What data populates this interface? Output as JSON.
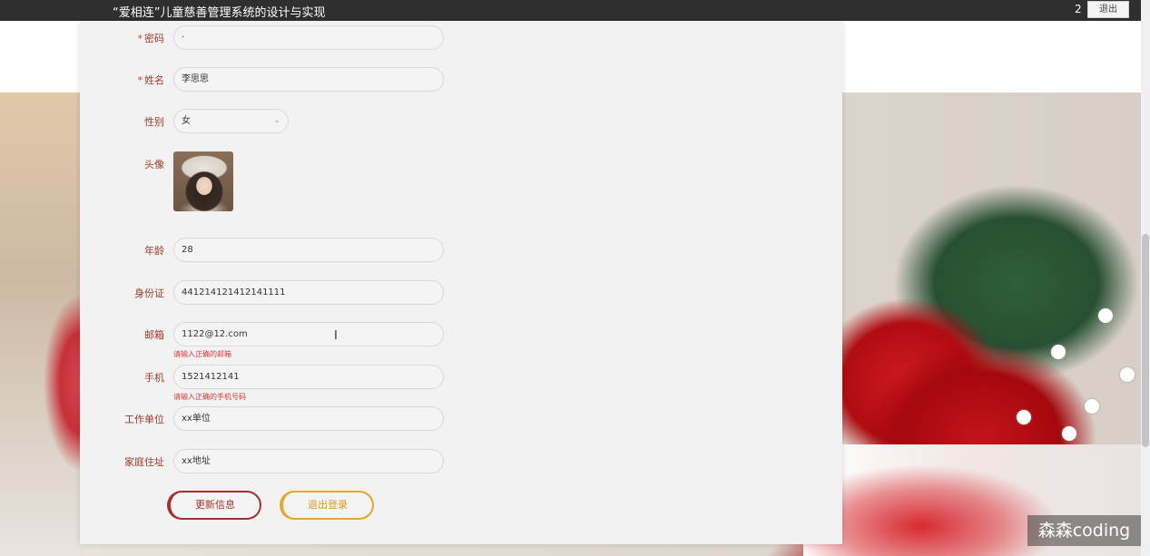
{
  "header": {
    "title": "“爱相连”儿童慈善管理系统的设计与实现",
    "user_number": "2",
    "logout_label": "退出"
  },
  "form": {
    "password": {
      "label": "密码",
      "required": "*",
      "value": "·"
    },
    "name": {
      "label": "姓名",
      "required": "*",
      "value": "李思思"
    },
    "gender": {
      "label": "性别",
      "value": "女"
    },
    "avatar": {
      "label": "头像"
    },
    "age": {
      "label": "年龄",
      "value": "28"
    },
    "id_card": {
      "label": "身份证",
      "value": "441214121412141111"
    },
    "email": {
      "label": "邮箱",
      "value": "1122@12.com",
      "error": "请输入正确的邮箱"
    },
    "phone": {
      "label": "手机",
      "value": "1521412141",
      "error": "请输入正确的手机号码"
    },
    "work_unit": {
      "label": "工作单位",
      "value": "xx单位"
    },
    "home_address": {
      "label": "家庭住址",
      "value": "xx地址"
    }
  },
  "buttons": {
    "update": "更新信息",
    "logout": "退出登录"
  },
  "watermark": "森森coding",
  "colors": {
    "label": "#9a3a2a",
    "error": "#d43a3a",
    "update_button": "#a3312a",
    "logout_button": "#e0a82c",
    "topbar": "#2f2f2f"
  }
}
